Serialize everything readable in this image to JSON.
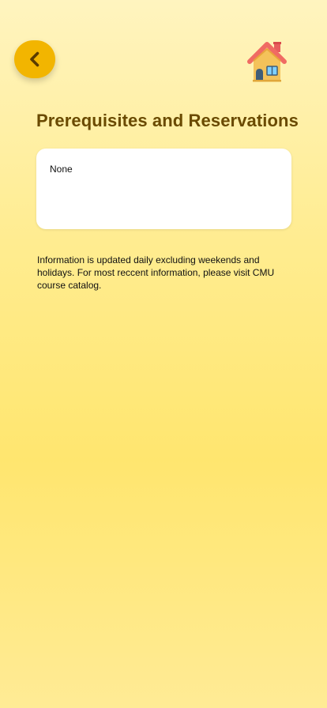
{
  "header": {
    "back_icon": "chevron-left-icon",
    "home_icon": "house-icon"
  },
  "page": {
    "title": "Prerequisites and Reservations",
    "card_text": "None",
    "info_text": "Information is updated daily excluding weekends and holidays. For most reccent information, please visit CMU course catalog."
  },
  "colors": {
    "accent": "#f2b500",
    "title": "#6a4a00",
    "background_top": "#fff4bf",
    "background_mid": "#ffe66f"
  }
}
